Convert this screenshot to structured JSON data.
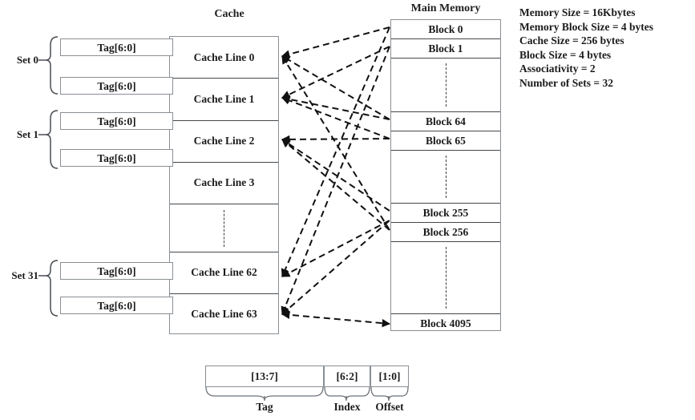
{
  "diagram": {
    "title_cache": "Cache",
    "title_memory": "Main Memory"
  },
  "cache": {
    "tag_label": "Tag[6:0]",
    "lines": [
      {
        "label": "Cache Line 0"
      },
      {
        "label": "Cache Line 1"
      },
      {
        "label": "Cache Line 2"
      },
      {
        "label": "Cache Line 3"
      },
      {
        "label": "Cache Line 62"
      },
      {
        "label": "Cache Line 63"
      }
    ],
    "tags": [
      {
        "label": "Tag[6:0]"
      },
      {
        "label": "Tag[6:0]"
      },
      {
        "label": "Tag[6:0]"
      },
      {
        "label": "Tag[6:0]"
      },
      {
        "label": "Tag[6:0]"
      },
      {
        "label": "Tag[6:0]"
      }
    ],
    "sets": [
      {
        "label": "Set 0"
      },
      {
        "label": "Set 1"
      },
      {
        "label": "Set 31"
      }
    ]
  },
  "memory": {
    "blocks": [
      {
        "label": "Block 0"
      },
      {
        "label": "Block 1"
      },
      {
        "label": "Block 64"
      },
      {
        "label": "Block 65"
      },
      {
        "label": "Block 255"
      },
      {
        "label": "Block 256"
      },
      {
        "label": "Block 4095"
      }
    ]
  },
  "specs": {
    "lines": [
      "Memory Size = 16Kbytes",
      "Memory Block Size = 4 bytes",
      "Cache Size = 256 bytes",
      "Block Size = 4 bytes",
      "Associativity = 2",
      "Number of Sets = 32"
    ]
  },
  "address": {
    "fields": [
      {
        "bits": "[13:7]",
        "name": "Tag"
      },
      {
        "bits": "[6:2]",
        "name": "Index"
      },
      {
        "bits": "[1:0]",
        "name": "Offset"
      }
    ]
  },
  "colors": {
    "box_border": "#8a8f94",
    "row_border": "#44484c",
    "text": "#1b1b1b",
    "mapping_arrow": "#1a1a1a"
  }
}
